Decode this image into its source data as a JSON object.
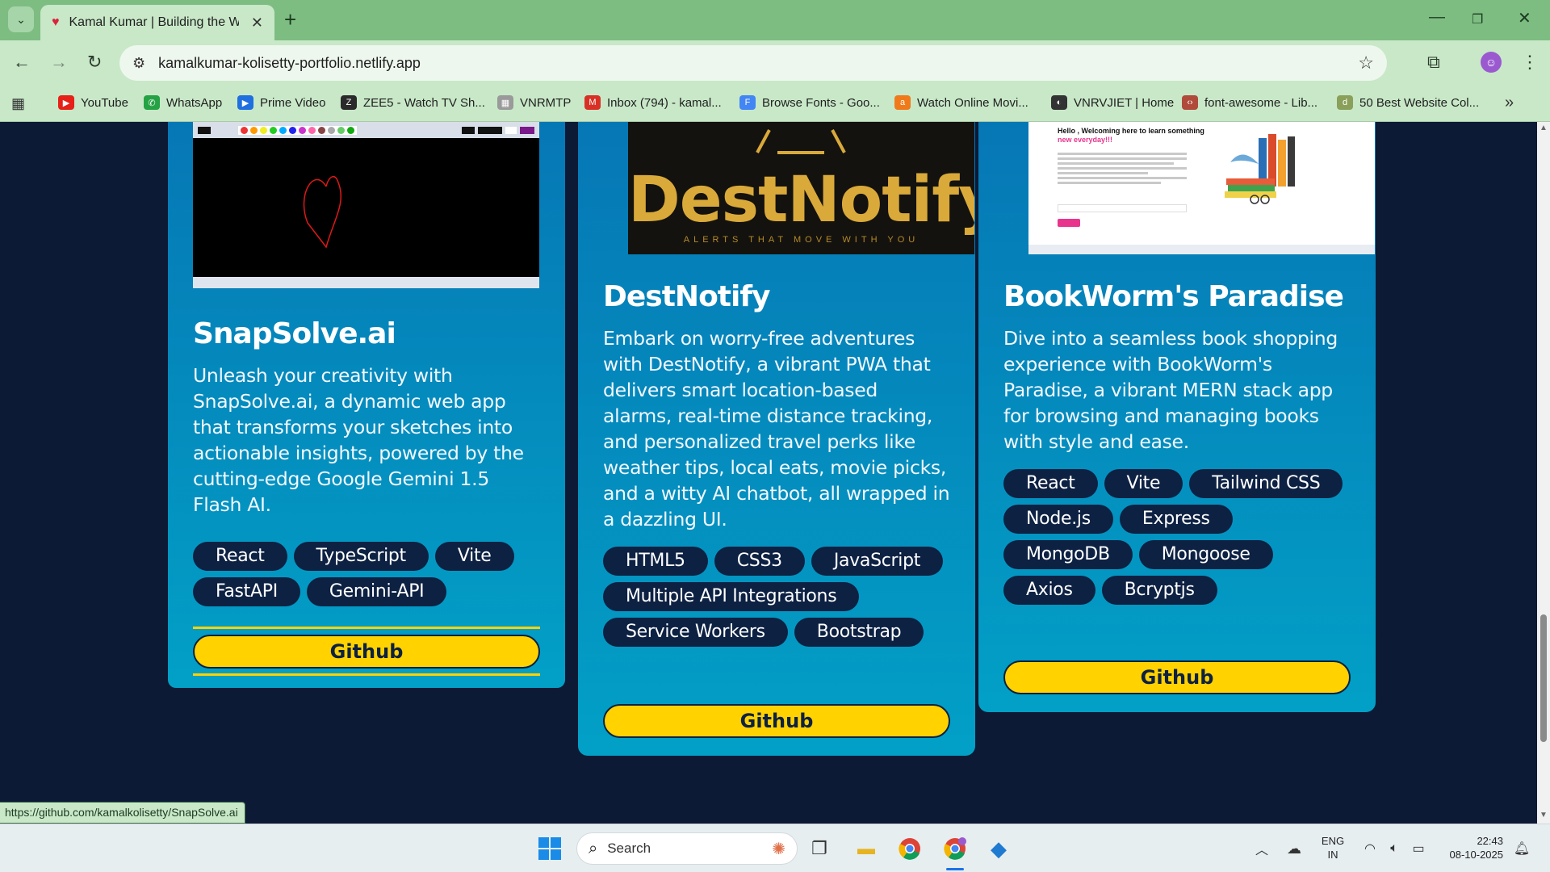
{
  "browser": {
    "tab_title": "Kamal Kumar | Building the Web",
    "url": "kamalkumar-kolisetty-portfolio.netlify.app",
    "bookmarks": [
      {
        "label": "YouTube",
        "color": "#e62117",
        "glyph": "▶"
      },
      {
        "label": "WhatsApp",
        "color": "#25a244",
        "glyph": "✆"
      },
      {
        "label": "Prime Video",
        "color": "#1f6fe0",
        "glyph": "▶"
      },
      {
        "label": "ZEE5 - Watch TV Sh...",
        "color": "#2a2a2a",
        "glyph": "Z"
      },
      {
        "label": "VNRMTP",
        "color": "#9a9a9a",
        "glyph": "▦"
      },
      {
        "label": "Inbox (794) - kamal...",
        "color": "#d93025",
        "glyph": "M"
      },
      {
        "label": "Browse Fonts - Goo...",
        "color": "#4285f4",
        "glyph": "F"
      },
      {
        "label": "Watch Online Movi...",
        "color": "#f07a1a",
        "glyph": "a"
      },
      {
        "label": "VNRVJIET | Home",
        "color": "#333333",
        "glyph": "◐"
      },
      {
        "label": "font-awesome - Lib...",
        "color": "#b04a3b",
        "glyph": "‹›"
      },
      {
        "label": "50 Best Website Col...",
        "color": "#8aa05a",
        "glyph": "d"
      }
    ],
    "status_url": "https://github.com/kamalkolisetty/SnapSolve.ai"
  },
  "projects": [
    {
      "title": "SnapSolve.ai",
      "description": "Unleash your creativity with SnapSolve.ai, a dynamic web app that transforms your sketches into actionable insights, powered by the cutting-edge Google Gemini 1.5 Flash AI.",
      "tags": [
        "React",
        "TypeScript",
        "Vite",
        "FastAPI",
        "Gemini-API"
      ],
      "github_label": "Github"
    },
    {
      "title": "DestNotify",
      "logo_text": "DestNotify",
      "logo_tagline": "ALERTS THAT MOVE WITH YOU",
      "description": "Embark on worry-free adventures with DestNotify, a vibrant PWA that delivers smart location-based alarms, real-time distance tracking, and personalized travel perks like weather tips, local eats, movie picks, and a witty AI chatbot, all wrapped in a dazzling UI.",
      "tags": [
        "HTML5",
        "CSS3",
        "JavaScript",
        "Multiple API Integrations",
        "Service Workers",
        "Bootstrap"
      ],
      "github_label": "Github"
    },
    {
      "title": "BookWorm's Paradise",
      "shot_heading": "Hello , Welcoming here to learn something",
      "shot_heading_highlight": "new everyday!!!",
      "description": "Dive into a seamless book shopping experience with BookWorm's Paradise, a vibrant MERN stack app for browsing and managing books with style and ease.",
      "tags": [
        "React",
        "Vite",
        "Tailwind CSS",
        "Node.js",
        "Express",
        "MongoDB",
        "Mongoose",
        "Axios",
        "Bcryptjs"
      ],
      "github_label": "Github"
    }
  ],
  "taskbar": {
    "search_label": "Search",
    "lang_top": "ENG",
    "lang_bottom": "IN",
    "time": "22:43",
    "date": "08-10-2025"
  },
  "colors": {
    "page_bg": "#0c1a35",
    "card_gradient_top": "#0677b5",
    "card_gradient_bottom": "#02a0c6",
    "tag_bg": "#0d2143",
    "button_yellow": "#ffd200",
    "browser_green": "#7dbd82"
  }
}
